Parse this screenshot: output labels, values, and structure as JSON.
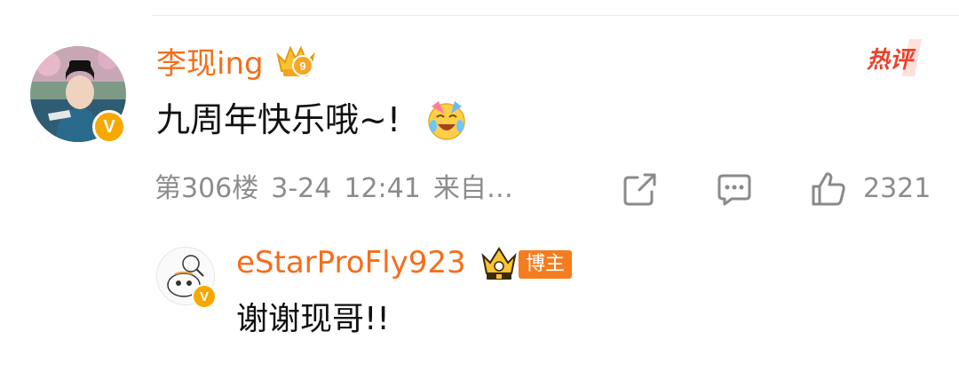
{
  "main_comment": {
    "username": "李现ing",
    "text": "九周年快乐哦~!",
    "hot_tag": "热评",
    "floor": "第306楼",
    "date": "3-24",
    "time": "12:41",
    "source": "来自…",
    "like_count": "2321",
    "verified_mark": "V",
    "vip_level": "9"
  },
  "reply": {
    "username": "eStarProFly923",
    "badge": "博主",
    "text": "谢谢现哥!!",
    "verified_mark": "V"
  },
  "icons": {
    "vip": "vip-crown-icon",
    "fan": "fan-crown-icon",
    "emoji": "crying-laughing-emoji",
    "share": "share-icon",
    "comment": "comment-icon",
    "like": "thumbs-up-icon"
  },
  "colors": {
    "username": "#f46e1b",
    "verified": "#f7a800",
    "meta": "#8c8c8c",
    "blogger_badge": "#f57c1f",
    "hot_tag": "#e8432a"
  }
}
